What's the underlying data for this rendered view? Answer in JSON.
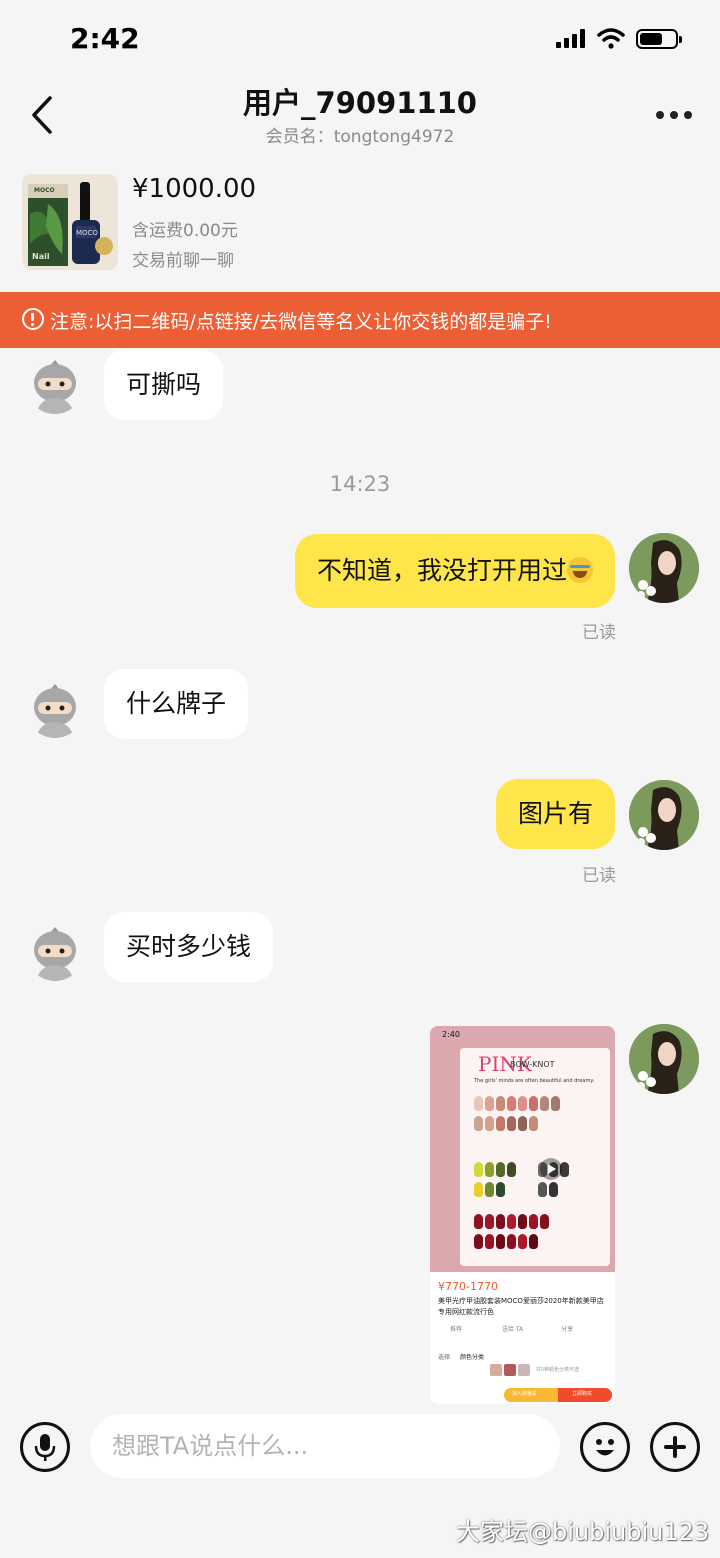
{
  "status_bar": {
    "time": "2:42",
    "battery_level": 0.65
  },
  "header": {
    "title": "用户_79091110",
    "subtitle": "会员名：tongtong4972",
    "back_icon": "chevron-left-icon",
    "more_icon": "more-horizontal-icon"
  },
  "product": {
    "price": "¥1000.00",
    "shipping": "含运费0.00元",
    "hint": "交易前聊一聊",
    "thumb_brand": "MOCO",
    "thumb_label": "Nail"
  },
  "warning": {
    "text": "注意:以扫二维码/点链接/去微信等名义让你交钱的都是骗子!",
    "color": "#ec5f35"
  },
  "messages": [
    {
      "side": "left",
      "text": "可撕吗"
    },
    {
      "type": "time",
      "text": "14:23"
    },
    {
      "side": "right",
      "text": "不知道，我没打开用过",
      "read": "已读"
    },
    {
      "side": "left",
      "text": "什么牌子"
    },
    {
      "side": "right",
      "text": "图片有",
      "read": "已读"
    },
    {
      "side": "left",
      "text": "买时多少钱"
    },
    {
      "side": "right",
      "type": "image",
      "screenshot": {
        "time": "2:40",
        "pink": "PINK",
        "bow": "BOW-KNOT",
        "tagline": "The girls' minds are often beautiful and dreamy.",
        "price": "¥770-1770",
        "desc": "美甲光疗甲油胶套装MOCO爱丽莎2020年新款美甲店专用网红款流行色",
        "action_recommend": "推荐",
        "action_chat": "送给 TA",
        "action_share": "分享",
        "select_label": "选择",
        "select_value": "颜色分类",
        "options_hint": "共5种颜色分类可选",
        "cart_label": "加入购物车",
        "buy_label": "立即购买"
      }
    }
  ],
  "input": {
    "placeholder": "想跟TA说点什么..."
  },
  "colors": {
    "bubble_self": "#fde54a",
    "bubble_other": "#ffffff",
    "background": "#f5f5f5"
  },
  "watermark": "大家坛@biubiubiu123"
}
